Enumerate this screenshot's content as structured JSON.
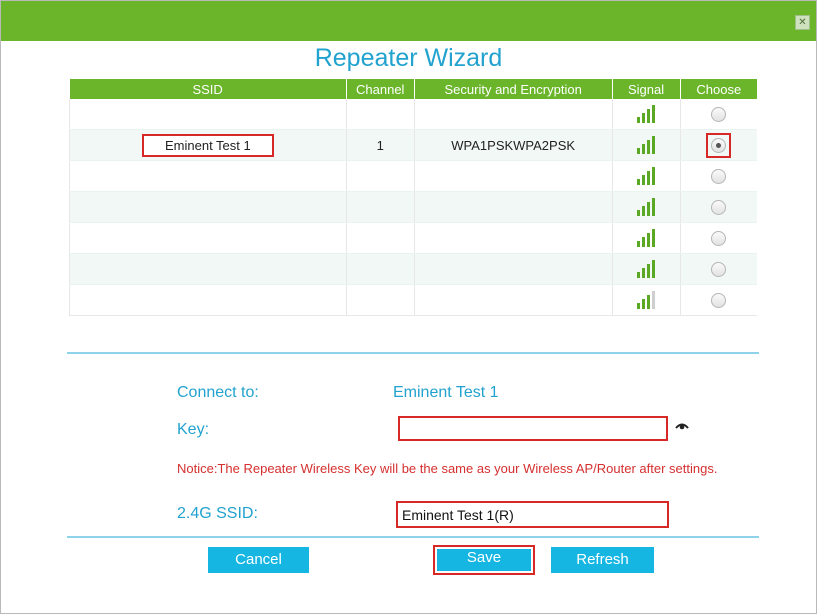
{
  "window": {
    "title": "Repeater Wizard",
    "close_glyph": "✕",
    "accent": "#6ab52a",
    "title_color": "#21a2cf"
  },
  "table": {
    "headers": [
      "SSID",
      "Channel",
      "Security and Encryption",
      "Signal",
      "Choose"
    ],
    "rows": [
      {
        "ssid": "",
        "channel": "",
        "security": "",
        "signal_bars": 4,
        "selected": false
      },
      {
        "ssid": "Eminent Test 1",
        "channel": "1",
        "security": "WPA1PSKWPA2PSK",
        "signal_bars": 4,
        "selected": true
      },
      {
        "ssid": "",
        "channel": "",
        "security": "",
        "signal_bars": 4,
        "selected": false
      },
      {
        "ssid": "",
        "channel": "",
        "security": "",
        "signal_bars": 4,
        "selected": false
      },
      {
        "ssid": "",
        "channel": "",
        "security": "",
        "signal_bars": 4,
        "selected": false
      },
      {
        "ssid": "",
        "channel": "",
        "security": "",
        "signal_bars": 4,
        "selected": false
      },
      {
        "ssid": "",
        "channel": "",
        "security": "",
        "signal_bars": 3,
        "selected": false
      }
    ]
  },
  "form": {
    "connect_label": "Connect to:",
    "connect_value": "Eminent Test 1",
    "key_label": "Key:",
    "key_value": "",
    "eye_icon": "eye-icon",
    "notice": "Notice:The Repeater Wireless Key will be the same as your Wireless AP/Router after settings.",
    "ssid_label": "2.4G SSID:",
    "ssid_value": "Eminent Test 1(R)"
  },
  "buttons": {
    "cancel": "Cancel",
    "save": "Save",
    "refresh": "Refresh",
    "color": "#16b6e3"
  }
}
